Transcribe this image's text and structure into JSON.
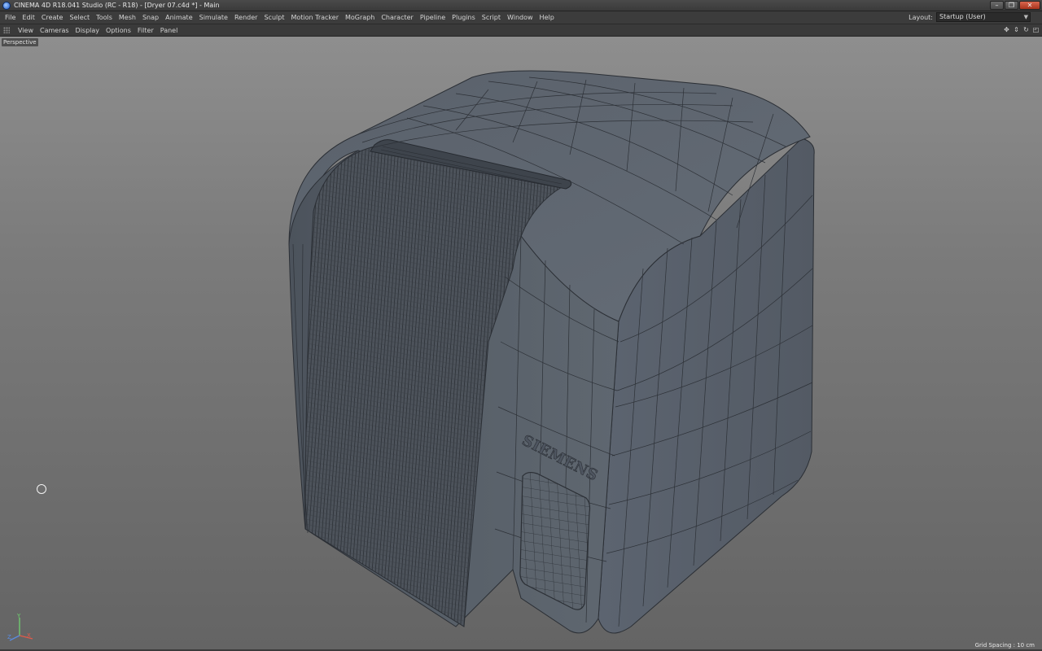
{
  "window": {
    "title": "CINEMA 4D R18.041 Studio (RC - R18) - [Dryer 07.c4d *] - Main",
    "buttons": [
      "–",
      "❐",
      "✕"
    ]
  },
  "menubar": {
    "items": [
      "File",
      "Edit",
      "Create",
      "Select",
      "Tools",
      "Mesh",
      "Snap",
      "Animate",
      "Simulate",
      "Render",
      "Sculpt",
      "Motion Tracker",
      "MoGraph",
      "Character",
      "Pipeline",
      "Plugins",
      "Script",
      "Window",
      "Help"
    ],
    "layout_label": "Layout:",
    "layout_value": "Startup (User)"
  },
  "viewport_menu": {
    "items": [
      "View",
      "Cameras",
      "Display",
      "Options",
      "Filter",
      "Panel"
    ],
    "tool_icons": [
      "move-view-icon",
      "dolly-icon",
      "rotate-view-icon",
      "toggle-view-icon"
    ]
  },
  "viewport": {
    "camera_label": "Perspective",
    "grid_spacing": "Grid Spacing : 10 cm",
    "model_text": "SIEMENS",
    "colors": {
      "background_top": "#8e8e8e",
      "background_bottom": "#646464",
      "mesh_fill": "#5e6670",
      "wire": "#2b2f35"
    }
  }
}
